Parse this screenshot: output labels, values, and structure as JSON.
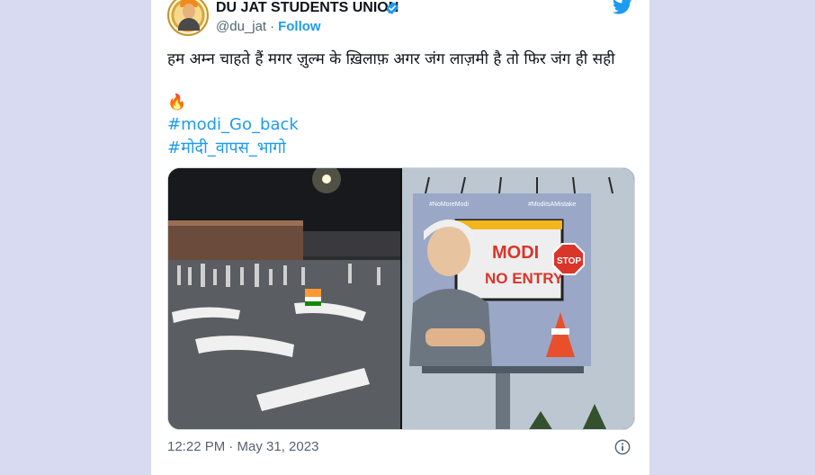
{
  "tweet": {
    "author_name": "DU JAT STUDENTS UNION",
    "handle": "@du_jat",
    "separator": "·",
    "follow_label": "Follow",
    "text": "हम अम्न चाहते हैं मगर ज़ुल्म के ख़िलाफ़ अगर जंग लाज़मी है तो फिर जंग ही सही",
    "emoji": "🔥",
    "hashtags": [
      "#modi_Go_back",
      "#मोदी_वापस_भागो"
    ],
    "time": "12:22 PM · May 31, 2023"
  },
  "images": {
    "left": {
      "road_text": "GO BACK MODI"
    },
    "right": {
      "tag_left": "#NoMoreModi",
      "tag_right": "#ModiIsAMistake",
      "headline_1": "MODI",
      "headline_2": "NO ENTRY",
      "stop_sign": "STOP"
    }
  },
  "icons": {
    "verified": "verified-badge-icon",
    "logo": "twitter-bird-icon",
    "info": "info-icon"
  },
  "colors": {
    "accent": "#1d9bf0",
    "text": "#0f1419",
    "muted": "#536471",
    "page_bg": "#d7daf0",
    "stop_red": "#d9352b"
  }
}
